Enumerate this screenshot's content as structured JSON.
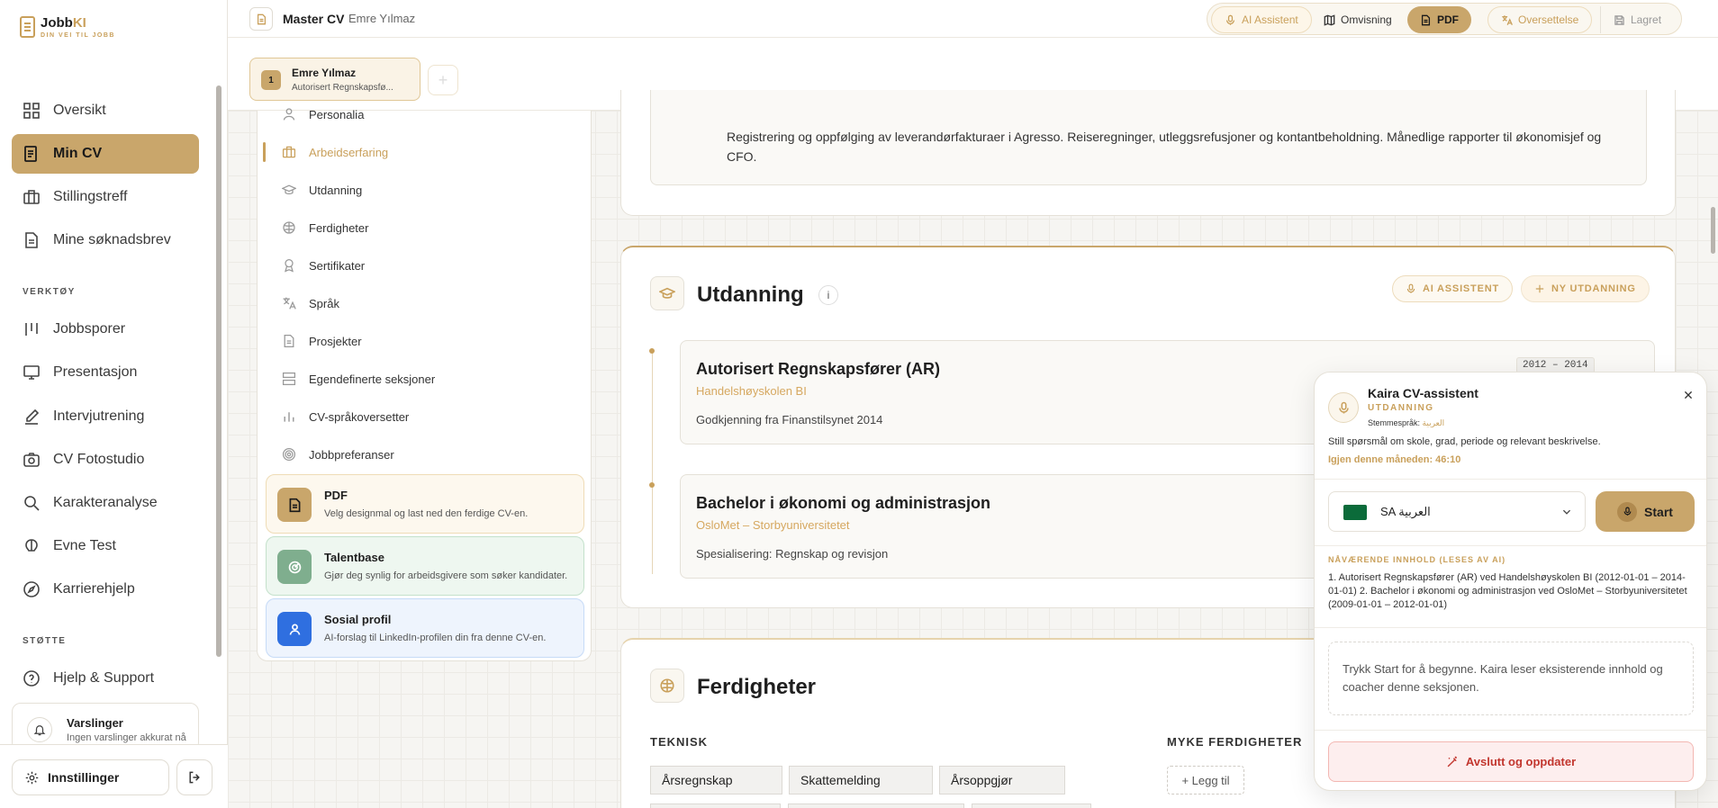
{
  "brand": {
    "name_a": "Jobb",
    "name_b": "KI",
    "tagline": "DIN VEI TIL JOBB"
  },
  "sidebar": {
    "main": [
      {
        "label": "Oversikt",
        "icon": "grid-icon"
      },
      {
        "label": "Min CV",
        "icon": "cv-icon",
        "active": true
      },
      {
        "label": "Stillingstreff",
        "icon": "briefcase-icon"
      },
      {
        "label": "Mine søknadsbrev",
        "icon": "letter-icon"
      }
    ],
    "tools_heading": "VERKTØY",
    "tools": [
      {
        "label": "Jobbsporer",
        "icon": "tracker-icon"
      },
      {
        "label": "Presentasjon",
        "icon": "monitor-icon"
      },
      {
        "label": "Intervjutrening",
        "icon": "pen-icon"
      },
      {
        "label": "CV Fotostudio",
        "icon": "camera-icon"
      },
      {
        "label": "Karakteranalyse",
        "icon": "search-icon"
      },
      {
        "label": "Evne Test",
        "icon": "brain-icon"
      },
      {
        "label": "Karrierehjelp",
        "icon": "compass-icon"
      }
    ],
    "support_heading": "STØTTE",
    "support": [
      {
        "label": "Hjelp & Support",
        "icon": "help-icon"
      }
    ],
    "notifications": {
      "title": "Varslinger",
      "text": "Ingen varslinger akkurat nå"
    },
    "settings_label": "Innstillinger"
  },
  "topbar": {
    "title": "Master CV",
    "subtitle": "Emre Yılmaz",
    "actions": {
      "ai": "AI Assistent",
      "preview": "Omvisning",
      "pdf": "PDF",
      "translate": "Oversettelse",
      "saved": "Lagret"
    }
  },
  "cv_tab": {
    "number": "1",
    "name": "Emre Yılmaz",
    "role": "Autorisert Regnskapsfø..."
  },
  "section_nav": {
    "items": [
      {
        "label": "Personalia",
        "icon": "user-icon"
      },
      {
        "label": "Arbeidserfaring",
        "icon": "briefcase-icon",
        "active": true
      },
      {
        "label": "Utdanning",
        "icon": "graduation-cap-icon"
      },
      {
        "label": "Ferdigheter",
        "icon": "brain-icon"
      },
      {
        "label": "Sertifikater",
        "icon": "award-icon"
      },
      {
        "label": "Språk",
        "icon": "language-icon"
      },
      {
        "label": "Prosjekter",
        "icon": "file-icon"
      },
      {
        "label": "Egendefinerte seksjoner",
        "icon": "layout-icon"
      },
      {
        "label": "CV-språkoversetter",
        "icon": "chart-icon"
      },
      {
        "label": "Jobbpreferanser",
        "icon": "target-icon"
      }
    ],
    "features": [
      {
        "title": "PDF",
        "desc": "Velg designmal og last ned den ferdige CV-en.",
        "icon": "pdf-icon",
        "color": "#c9a66b"
      },
      {
        "title": "Talentbase",
        "desc": "Gjør deg synlig for arbeidsgivere som søker kandidater.",
        "icon": "radar-icon",
        "color": "#7fae8e"
      },
      {
        "title": "Sosial profil",
        "desc": "AI-forslag til LinkedIn-profilen din fra denne CV-en.",
        "icon": "profile-icon",
        "color": "#2f6fe0"
      }
    ]
  },
  "work_excerpt": {
    "description": "Registrering og oppfølging av leverandørfakturaer i Agresso. Reiseregninger, utleggsrefusjoner og kontantbeholdning. Månedlige rapporter til økonomisjef og CFO."
  },
  "education": {
    "title": "Utdanning",
    "ai_button": "AI ASSISTENT",
    "new_button": "NY UTDANNING",
    "entries": [
      {
        "degree": "Autorisert Regnskapsfører (AR)",
        "school": "Handelshøyskolen BI",
        "description": "Godkjenning fra Finanstilsynet 2014",
        "dates": "2012 – 2014"
      },
      {
        "degree": "Bachelor i økonomi og administrasjon",
        "school": "OsloMet – Storbyuniversitetet",
        "description": "Spesialisering: Regnskap og revisjon"
      }
    ]
  },
  "skills": {
    "title": "Ferdigheter",
    "technical_label": "TEKNISK",
    "technical": [
      "Årsregnskap",
      "Skattemelding",
      "Årsoppgjør"
    ],
    "soft_label": "MYKE FERDIGHETER",
    "add_label": "+ Legg til"
  },
  "assistant": {
    "title": "Kaira CV-assistent",
    "section": "UTDANNING",
    "voice_label": "Stemmespråk:",
    "voice_value": "العربية",
    "description": "Still spørsmål om skole, grad, periode og relevant beskrivelse.",
    "quota": "Igjen denne måneden: 46:10",
    "language": "SA العربية",
    "start": "Start",
    "current_heading": "NÅVÆRENDE INNHOLD (LESES AV AI)",
    "current_content": "1. Autorisert Regnskapsfører (AR) ved Handelshøyskolen BI (2012-01-01 – 2014-01-01) 2. Bachelor i økonomi og administrasjon ved OsloMet – Storbyuniversitetet (2009-01-01 – 2012-01-01)",
    "hint": "Trykk Start for å begynne. Kaira leser eksisterende innhold og coacher denne seksjonen.",
    "finish": "Avslutt og oppdater"
  },
  "colors": {
    "accent": "#c9a66b",
    "accent_text": "#c9a05b",
    "danger": "#c2362e"
  }
}
